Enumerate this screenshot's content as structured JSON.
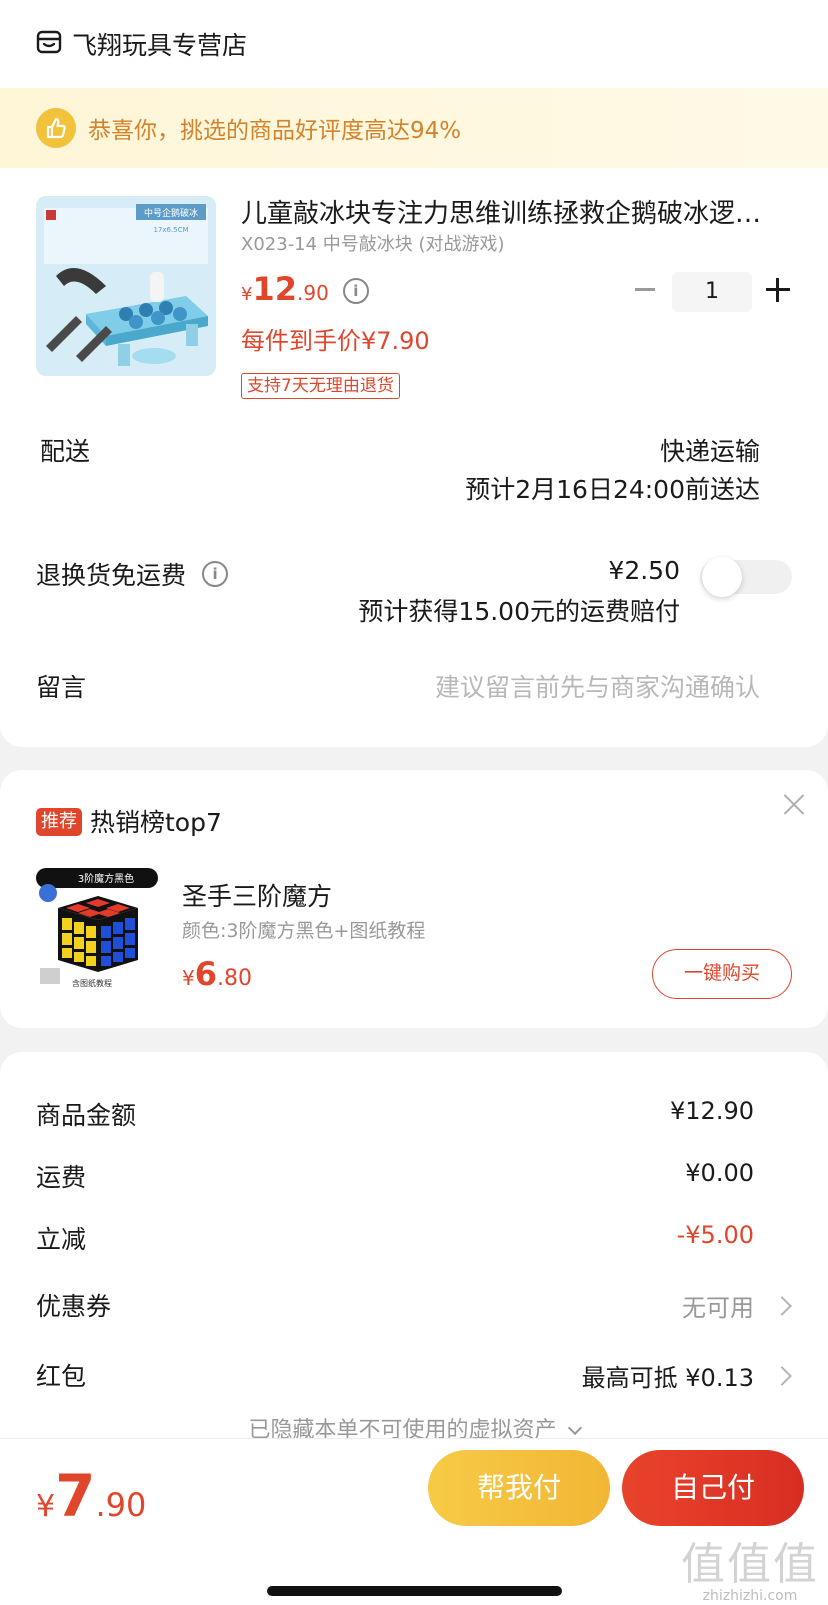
{
  "shop": {
    "name": "飞翔玩具专营店",
    "icon": "shop-icon"
  },
  "banner": {
    "text": "恭喜你，挑选的商品好评度高达94%",
    "icon": "thumbs-up-icon"
  },
  "product": {
    "title": "儿童敲冰块专注力思维训练拯救企鹅破冰逻辑桌游",
    "spec": "X023-14 中号敲冰块 (对战游戏)",
    "price": {
      "yen": "¥",
      "int": "12",
      "dec": ".90"
    },
    "per_price": "每件到手价¥7.90",
    "badge": "支持7天无理由退货",
    "qty": "1",
    "image_labels": {
      "box": "中号企鹅破冰",
      "size": "17x6.5CM"
    }
  },
  "delivery": {
    "label": "配送",
    "method": "快递运输",
    "eta": "预计2月16日24:00前送达"
  },
  "return_insurance": {
    "label": "退换货免运费",
    "price": "¥2.50",
    "note": "预计获得15.00元的运费赔付",
    "enabled": false
  },
  "message": {
    "label": "留言",
    "placeholder": "建议留言前先与商家沟通确认"
  },
  "recommend": {
    "badge": "推荐",
    "title": "热销榜top7",
    "item": {
      "name": "圣手三阶魔方",
      "spec": "颜色:3阶魔方黑色+图纸教程",
      "price": {
        "yen": "¥",
        "int": "6",
        "dec": ".80"
      },
      "buy_label": "一键购买",
      "image_labels": {
        "top": "3阶魔方黑色",
        "bottom": "含图纸教程"
      }
    }
  },
  "summary": {
    "rows": [
      {
        "label": "商品金额",
        "value": "¥12.90"
      },
      {
        "label": "运费",
        "value": "¥0.00"
      },
      {
        "label": "立减",
        "value": "-¥5.00"
      },
      {
        "label": "优惠券",
        "value": "无可用"
      },
      {
        "label": "红包",
        "value": "最高可抵 ¥0.13"
      }
    ],
    "hidden_note": "已隐藏本单不可使用的虚拟资产"
  },
  "bottom": {
    "total": {
      "yen": "¥",
      "int": "7",
      "dec": ".90"
    },
    "help_pay": "帮我付",
    "self_pay": "自己付"
  },
  "watermark": {
    "chars": "值值值",
    "site": "zhizhizhi.com"
  },
  "colors": {
    "accent": "#e0462c",
    "gold": "#f3c23b",
    "banner_text": "#d2832b"
  }
}
